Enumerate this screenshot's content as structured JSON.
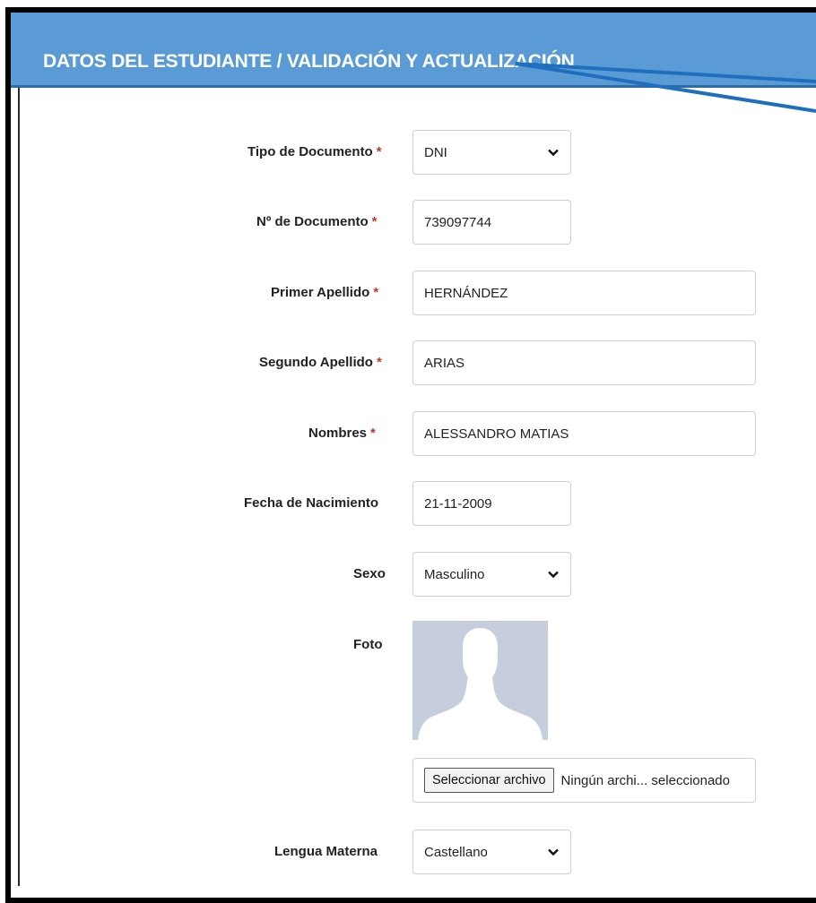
{
  "header": {
    "title": "DATOS DEL ESTUDIANTE / VALIDACIÓN Y ACTUALIZACIÓN"
  },
  "required_mark": "*",
  "form": {
    "tipo_documento": {
      "label": "Tipo de Documento",
      "value": "DNI"
    },
    "numero_documento": {
      "label": "Nº de Documento",
      "value": "739097744"
    },
    "primer_apellido": {
      "label": "Primer Apellido",
      "value": "HERNÁNDEZ"
    },
    "segundo_apellido": {
      "label": "Segundo Apellido",
      "value": "ARIAS"
    },
    "nombres": {
      "label": "Nombres",
      "value": "ALESSANDRO MATIAS"
    },
    "fecha_nacimiento": {
      "label": "Fecha de Nacimiento",
      "value": "21-11-2009"
    },
    "sexo": {
      "label": "Sexo",
      "value": "Masculino"
    },
    "foto": {
      "label": "Foto",
      "button_label": "Seleccionar archivo",
      "status": "Ningún archi... seleccionado"
    },
    "lengua_materna": {
      "label": "Lengua Materna",
      "value": "Castellano"
    }
  },
  "colors": {
    "header_bg": "#5b9bd5",
    "required": "#c0392b",
    "annotation_line": "#1f6fbf",
    "photo_bg": "#c6cede"
  }
}
